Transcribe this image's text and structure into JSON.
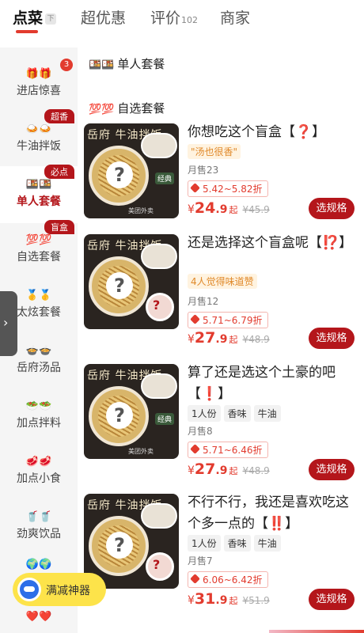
{
  "tabs": [
    {
      "label": "点菜",
      "tag": "下"
    },
    {
      "label": "超优惠"
    },
    {
      "label": "评价",
      "count": "102"
    },
    {
      "label": "商家"
    }
  ],
  "sidebar": {
    "items": [
      {
        "icons": "🎁🎁",
        "label": "进店惊喜",
        "dot": "3"
      },
      {
        "icons": "🍛🍛",
        "label": "牛油拌饭",
        "badge": "超香"
      },
      {
        "icons": "🍱🍱",
        "label": "单人套餐",
        "badge": "必点"
      },
      {
        "icons": "💯💯",
        "label": "自选套餐",
        "badge": "盲盒"
      },
      {
        "icons": "🥇🥇",
        "label": "太炫套餐"
      },
      {
        "icons": "🍲🍲",
        "label": "岳府汤品"
      },
      {
        "icons": "🥗🥗",
        "label": "加点拌料"
      },
      {
        "icons": "🥩🥩",
        "label": "加点小食"
      },
      {
        "icons": "🥤🥤",
        "label": "劲爽饮品"
      },
      {
        "icons": "🌍🌍",
        "label": ""
      },
      {
        "icons": "❤️❤️",
        "label": ""
      }
    ],
    "handle": "›"
  },
  "promo": {
    "label": "满减神器"
  },
  "sections": {
    "single": {
      "icon": "🍱🍱",
      "title": "单人套餐"
    },
    "custom": {
      "icon": "💯💯",
      "title": "自选套餐"
    }
  },
  "products": [
    {
      "thumb_brand": "岳府 牛油拌饭",
      "title": "你想吃这个盲盒【",
      "mark": "❓",
      "title_end": "】",
      "tagline": "\"汤也很香\"",
      "tags": [],
      "sales": "月售23",
      "discount": "5.42~5.82折",
      "price_cur": "¥",
      "price_int": "24",
      "price_dec": ".9",
      "price_qi": "起",
      "orig_price": "¥45.9",
      "button": "选规格"
    },
    {
      "thumb_brand": "岳府 牛油拌饭",
      "title": "还是选择这个盲盒呢【",
      "mark": "⁉️",
      "title_end": "】",
      "tagline": "4人觉得味道赞",
      "tags": [],
      "sales": "月售12",
      "discount": "5.71~6.79折",
      "price_cur": "¥",
      "price_int": "27",
      "price_dec": ".9",
      "price_qi": "起",
      "orig_price": "¥48.9",
      "button": "选规格"
    },
    {
      "thumb_brand": "岳府 牛油拌饭",
      "title": "算了还是选这个土豪的吧【",
      "mark": "❗",
      "title_end": "】",
      "tagline": "",
      "tags": [
        "1人份",
        "香味",
        "牛油"
      ],
      "sales": "月售8",
      "discount": "5.71~6.46折",
      "price_cur": "¥",
      "price_int": "27",
      "price_dec": ".9",
      "price_qi": "起",
      "orig_price": "¥48.9",
      "button": "选规格"
    },
    {
      "thumb_brand": "岳府 牛油拌饭",
      "title": "不行不行，我还是喜欢吃这个多一点的【",
      "mark": "‼️",
      "title_end": "】",
      "tagline": "",
      "tags": [
        "1人份",
        "香味",
        "牛油"
      ],
      "sales": "月售7",
      "discount": "6.06~6.42折",
      "price_cur": "¥",
      "price_int": "31",
      "price_dec": ".9",
      "price_qi": "起",
      "orig_price": "¥51.9",
      "button": "选规格"
    }
  ],
  "thumb_stamp": "经典",
  "thumb_watermark": "美团外卖",
  "colors": {
    "accent": "#b4161b",
    "price": "#e23b2e",
    "tagline": "#e0892a"
  }
}
